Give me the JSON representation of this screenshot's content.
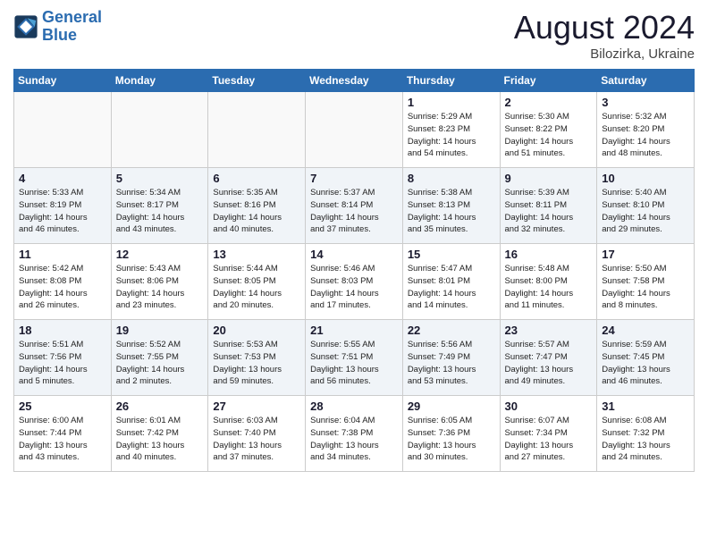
{
  "header": {
    "logo_line1": "General",
    "logo_line2": "Blue",
    "month_year": "August 2024",
    "location": "Bilozirka, Ukraine"
  },
  "weekdays": [
    "Sunday",
    "Monday",
    "Tuesday",
    "Wednesday",
    "Thursday",
    "Friday",
    "Saturday"
  ],
  "weeks": [
    [
      {
        "day": "",
        "info": ""
      },
      {
        "day": "",
        "info": ""
      },
      {
        "day": "",
        "info": ""
      },
      {
        "day": "",
        "info": ""
      },
      {
        "day": "1",
        "info": "Sunrise: 5:29 AM\nSunset: 8:23 PM\nDaylight: 14 hours\nand 54 minutes."
      },
      {
        "day": "2",
        "info": "Sunrise: 5:30 AM\nSunset: 8:22 PM\nDaylight: 14 hours\nand 51 minutes."
      },
      {
        "day": "3",
        "info": "Sunrise: 5:32 AM\nSunset: 8:20 PM\nDaylight: 14 hours\nand 48 minutes."
      }
    ],
    [
      {
        "day": "4",
        "info": "Sunrise: 5:33 AM\nSunset: 8:19 PM\nDaylight: 14 hours\nand 46 minutes."
      },
      {
        "day": "5",
        "info": "Sunrise: 5:34 AM\nSunset: 8:17 PM\nDaylight: 14 hours\nand 43 minutes."
      },
      {
        "day": "6",
        "info": "Sunrise: 5:35 AM\nSunset: 8:16 PM\nDaylight: 14 hours\nand 40 minutes."
      },
      {
        "day": "7",
        "info": "Sunrise: 5:37 AM\nSunset: 8:14 PM\nDaylight: 14 hours\nand 37 minutes."
      },
      {
        "day": "8",
        "info": "Sunrise: 5:38 AM\nSunset: 8:13 PM\nDaylight: 14 hours\nand 35 minutes."
      },
      {
        "day": "9",
        "info": "Sunrise: 5:39 AM\nSunset: 8:11 PM\nDaylight: 14 hours\nand 32 minutes."
      },
      {
        "day": "10",
        "info": "Sunrise: 5:40 AM\nSunset: 8:10 PM\nDaylight: 14 hours\nand 29 minutes."
      }
    ],
    [
      {
        "day": "11",
        "info": "Sunrise: 5:42 AM\nSunset: 8:08 PM\nDaylight: 14 hours\nand 26 minutes."
      },
      {
        "day": "12",
        "info": "Sunrise: 5:43 AM\nSunset: 8:06 PM\nDaylight: 14 hours\nand 23 minutes."
      },
      {
        "day": "13",
        "info": "Sunrise: 5:44 AM\nSunset: 8:05 PM\nDaylight: 14 hours\nand 20 minutes."
      },
      {
        "day": "14",
        "info": "Sunrise: 5:46 AM\nSunset: 8:03 PM\nDaylight: 14 hours\nand 17 minutes."
      },
      {
        "day": "15",
        "info": "Sunrise: 5:47 AM\nSunset: 8:01 PM\nDaylight: 14 hours\nand 14 minutes."
      },
      {
        "day": "16",
        "info": "Sunrise: 5:48 AM\nSunset: 8:00 PM\nDaylight: 14 hours\nand 11 minutes."
      },
      {
        "day": "17",
        "info": "Sunrise: 5:50 AM\nSunset: 7:58 PM\nDaylight: 14 hours\nand 8 minutes."
      }
    ],
    [
      {
        "day": "18",
        "info": "Sunrise: 5:51 AM\nSunset: 7:56 PM\nDaylight: 14 hours\nand 5 minutes."
      },
      {
        "day": "19",
        "info": "Sunrise: 5:52 AM\nSunset: 7:55 PM\nDaylight: 14 hours\nand 2 minutes."
      },
      {
        "day": "20",
        "info": "Sunrise: 5:53 AM\nSunset: 7:53 PM\nDaylight: 13 hours\nand 59 minutes."
      },
      {
        "day": "21",
        "info": "Sunrise: 5:55 AM\nSunset: 7:51 PM\nDaylight: 13 hours\nand 56 minutes."
      },
      {
        "day": "22",
        "info": "Sunrise: 5:56 AM\nSunset: 7:49 PM\nDaylight: 13 hours\nand 53 minutes."
      },
      {
        "day": "23",
        "info": "Sunrise: 5:57 AM\nSunset: 7:47 PM\nDaylight: 13 hours\nand 49 minutes."
      },
      {
        "day": "24",
        "info": "Sunrise: 5:59 AM\nSunset: 7:45 PM\nDaylight: 13 hours\nand 46 minutes."
      }
    ],
    [
      {
        "day": "25",
        "info": "Sunrise: 6:00 AM\nSunset: 7:44 PM\nDaylight: 13 hours\nand 43 minutes."
      },
      {
        "day": "26",
        "info": "Sunrise: 6:01 AM\nSunset: 7:42 PM\nDaylight: 13 hours\nand 40 minutes."
      },
      {
        "day": "27",
        "info": "Sunrise: 6:03 AM\nSunset: 7:40 PM\nDaylight: 13 hours\nand 37 minutes."
      },
      {
        "day": "28",
        "info": "Sunrise: 6:04 AM\nSunset: 7:38 PM\nDaylight: 13 hours\nand 34 minutes."
      },
      {
        "day": "29",
        "info": "Sunrise: 6:05 AM\nSunset: 7:36 PM\nDaylight: 13 hours\nand 30 minutes."
      },
      {
        "day": "30",
        "info": "Sunrise: 6:07 AM\nSunset: 7:34 PM\nDaylight: 13 hours\nand 27 minutes."
      },
      {
        "day": "31",
        "info": "Sunrise: 6:08 AM\nSunset: 7:32 PM\nDaylight: 13 hours\nand 24 minutes."
      }
    ]
  ]
}
